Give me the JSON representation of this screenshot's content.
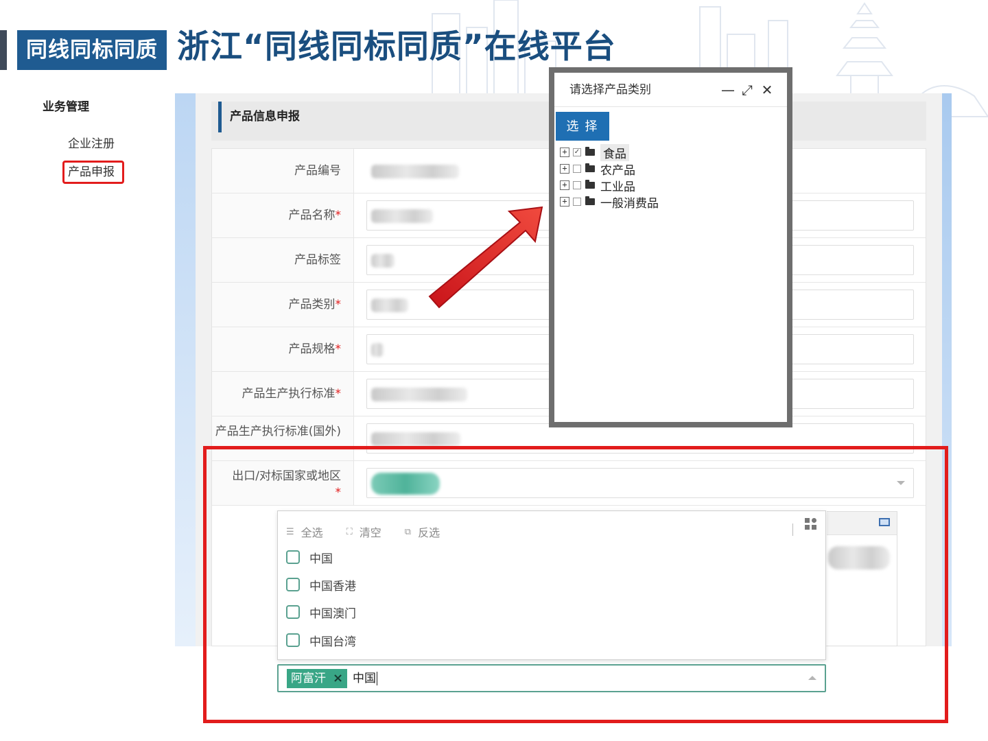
{
  "header": {
    "tag": "同线同标同质",
    "title": "浙江“同线同标同质”在线平台"
  },
  "sidebar": {
    "heading": "业务管理",
    "items": [
      {
        "label": "企业注册"
      },
      {
        "label": "产品申报",
        "active": true
      }
    ]
  },
  "panel": {
    "title": "产品信息申报"
  },
  "form": {
    "rows": [
      {
        "label": "产品编号",
        "required": false
      },
      {
        "label": "产品名称",
        "required": true
      },
      {
        "label": "产品标签",
        "required": false
      },
      {
        "label": "产品类别",
        "required": true
      },
      {
        "label": "产品规格",
        "required": true
      },
      {
        "label": "产品生产执行标准",
        "required": true
      },
      {
        "label": "产品生产执行标准(国外)",
        "required": false
      },
      {
        "label": "出口/对标国家或地区",
        "required": true
      }
    ],
    "required_mark": "*"
  },
  "dialog": {
    "title": "请选择产品类别",
    "select_label": "选 择",
    "minimize_icon": "minimize-icon",
    "maximize_icon": "maximize-icon",
    "close_icon": "close-icon",
    "tree": [
      {
        "label": "食品",
        "checked": true,
        "highlighted": true
      },
      {
        "label": "农产品",
        "checked": false
      },
      {
        "label": "工业品",
        "checked": false
      },
      {
        "label": "一般消费品",
        "checked": false
      }
    ]
  },
  "country_select": {
    "toolbar": {
      "select_all": "全选",
      "clear": "清空",
      "invert": "反选"
    },
    "options": [
      {
        "label": "中国",
        "checked": false
      },
      {
        "label": "中国香港",
        "checked": false
      },
      {
        "label": "中国澳门",
        "checked": false
      },
      {
        "label": "中国台湾",
        "checked": false
      }
    ],
    "selected_tags": [
      {
        "label": "阿富汗",
        "remove": "×"
      }
    ],
    "typed_text": "中国"
  },
  "colors": {
    "brand": "#1f5b91",
    "highlight": "#e21c1c",
    "tag": "#39a686",
    "checkbox": "#5aa190"
  }
}
